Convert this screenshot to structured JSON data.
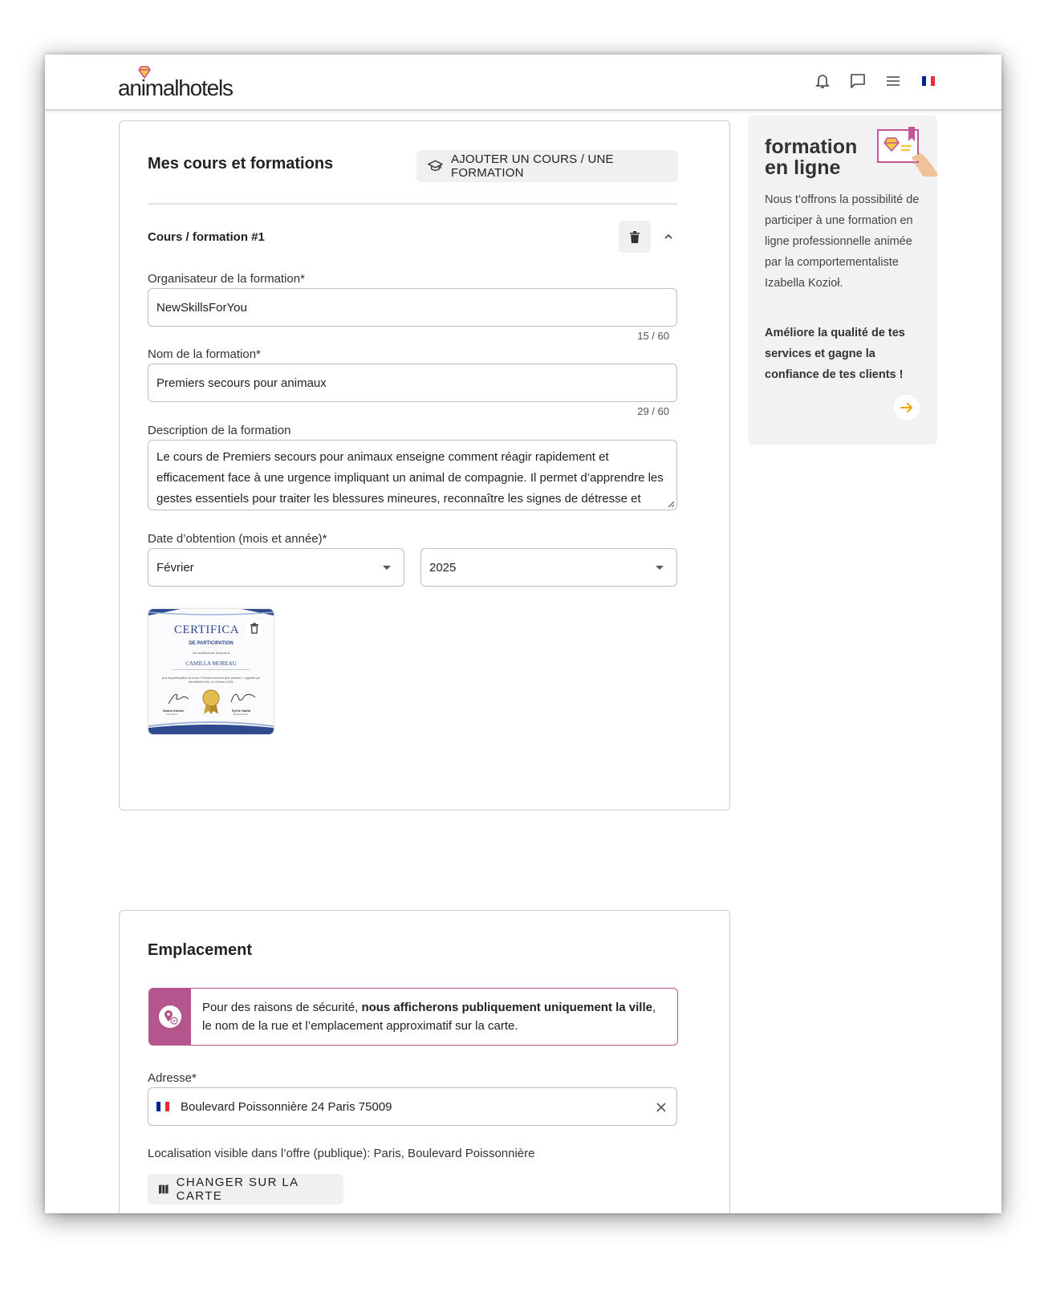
{
  "header": {
    "logo_text": "animalhotels",
    "icons": [
      "bell-icon",
      "chat-icon",
      "menu-icon",
      "french-flag-icon"
    ]
  },
  "courses": {
    "title": "Mes cours et formations",
    "add_button": "AJOUTER UN COURS / UNE FORMATION",
    "item_title": "Cours / formation #1",
    "organizer_label": "Organisateur de la formation*",
    "organizer_value": "NewSkillsForYou",
    "organizer_counter": "15 / 60",
    "name_label": "Nom de la formation*",
    "name_value": "Premiers secours pour animaux",
    "name_counter": "29 / 60",
    "description_label": "Description de la formation",
    "description_value": "Le cours de Premiers secours pour animaux enseigne comment réagir rapidement et efficacement face à une urgence impliquant un animal de compagnie. Il permet d’apprendre les gestes essentiels pour traiter les blessures mineures, reconnaître les signes de détresse et stabiliser l’animal avant",
    "date_label": "Date d’obtention (mois et année)*",
    "month_value": "Février",
    "year_value": "2025",
    "certificate": {
      "title": "CERTIFICA",
      "subtitle": "DE PARTICIPATION",
      "line": "Ce certificat est décerné à",
      "name": "CAMILLA MOREAU",
      "body": "pour sa participation au cours « Premiers secours pour animaux » organisé par NewSkillsForYou, le 12 février 2025.",
      "sign1_name": "Sasha Dubois",
      "sign1_role": "Formatrice",
      "sign2_name": "Eyrlie Hadid",
      "sign2_role": "Représentant"
    }
  },
  "sidebar": {
    "title_line1": "formation",
    "title_line2": "en ligne",
    "text": "Nous t’offrons la possibilité de participer à une formation en ligne professionnelle animée par la comportementaliste Izabella Kozioł.",
    "bold_text": "Améliore la qualité de tes services et gagne la confiance de tes clients !"
  },
  "location": {
    "title": "Emplacement",
    "notice_prefix": "Pour des raisons de sécurité, ",
    "notice_bold": "nous afficherons publiquement uniquement la ville",
    "notice_suffix": ", le nom de la rue et l’emplacement approximatif sur la carte.",
    "address_label": "Adresse*",
    "address_value": "Boulevard Poissonnière 24 Paris 75009",
    "visible_text": "Localisation visible dans l’offre (publique): Paris, Boulevard Poissonnière",
    "map_button": "CHANGER SUR LA CARTE"
  },
  "colors": {
    "accent": "#b5558d",
    "arrow": "#f0a500",
    "flag_blue": "#002395",
    "flag_red": "#ed2939"
  }
}
